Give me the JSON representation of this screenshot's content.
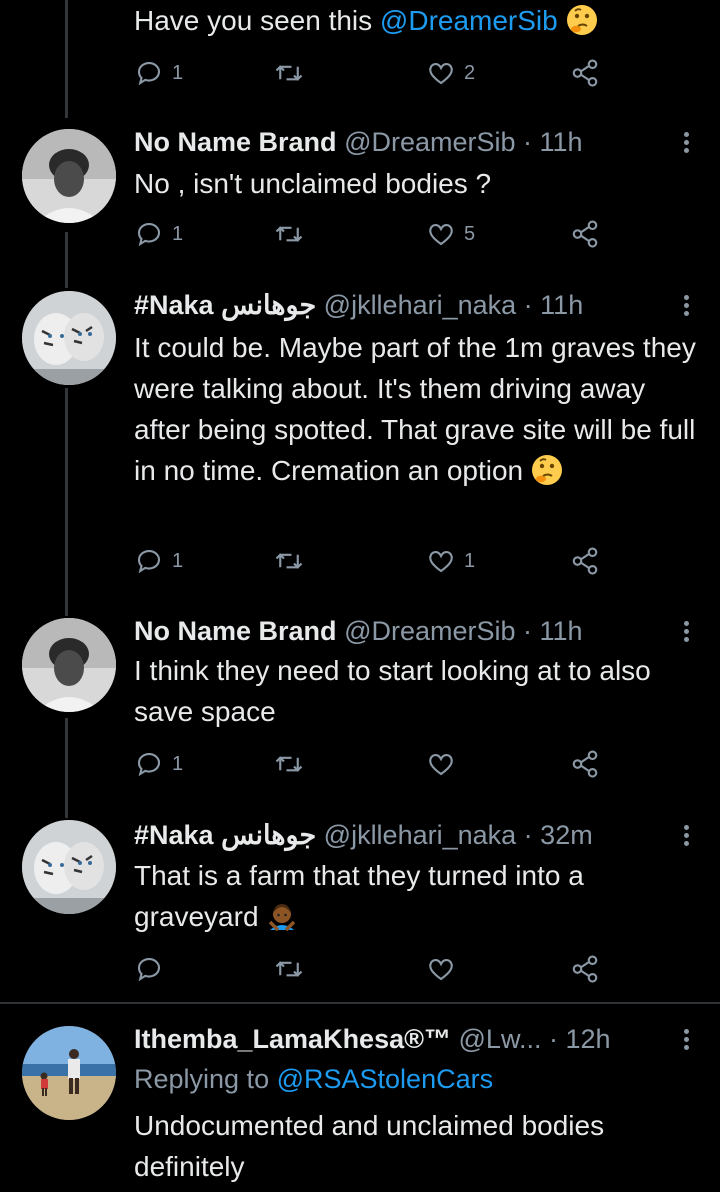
{
  "top_partial": {
    "text_before": "Have you seen this ",
    "mention": "@DreamerSib",
    "emoji": "thinking-face-emoji",
    "replies": "1",
    "likes": "2"
  },
  "tweets": [
    {
      "name": "No Name Brand",
      "handle": "@DreamerSib",
      "time": "11h",
      "text": "No , isn't unclaimed bodies ?",
      "replies": "1",
      "likes": "5"
    },
    {
      "name": "#Naka",
      "name_arabic": "جوهانس",
      "handle": "@jkllehari_naka",
      "time": "11h",
      "text": "It could be. Maybe part of the 1m graves they were talking about. It's them driving away after being spotted. That grave site will be full in no time. Cremation an option",
      "emoji": "thinking-face-emoji",
      "replies": "1",
      "likes": "1"
    },
    {
      "name": "No Name Brand",
      "handle": "@DreamerSib",
      "time": "11h",
      "text": "I think they need to start looking at to also save space",
      "replies": "1",
      "likes": ""
    },
    {
      "name": "#Naka",
      "name_arabic": "جوهانس",
      "handle": "@jkllehari_naka",
      "time": "32m",
      "text": "That is a farm that they turned into a graveyard",
      "emoji": "person-gesturing-no-emoji",
      "replies": "",
      "likes": ""
    },
    {
      "name": "Ithemba_LamaKhesa®™",
      "handle": "@Lw...",
      "time": "12h",
      "replying_to_label": "Replying to",
      "replying_to_handle": "@RSAStolenCars",
      "text": "Undocumented and unclaimed bodies definitely"
    }
  ],
  "separator": " · ",
  "colors": {
    "background": "#000000",
    "text": "#e7e9ea",
    "secondary": "#8b98a5",
    "accent": "#1d9bf0"
  }
}
